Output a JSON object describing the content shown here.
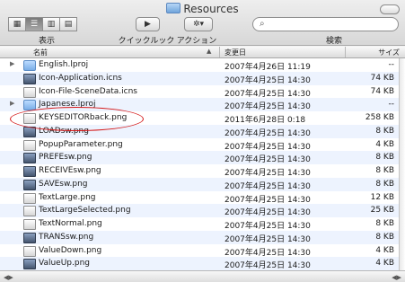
{
  "window": {
    "title": "Resources"
  },
  "toolbar": {
    "view_label": "表示",
    "quicklook_label": "クイックルック",
    "action_label": "アクション",
    "search_label": "検索"
  },
  "columns": {
    "name": "名前",
    "date": "変更日",
    "size": "サイズ"
  },
  "files": [
    {
      "name": "English.lproj",
      "date": "2007年4月26日 11:19",
      "size": "--",
      "type": "folder",
      "expanded": false
    },
    {
      "name": "Icon-Application.icns",
      "date": "2007年4月25日 14:30",
      "size": "74 KB",
      "type": "icns"
    },
    {
      "name": "Icon-File-SceneData.icns",
      "date": "2007年4月25日 14:30",
      "size": "74 KB",
      "type": "icns"
    },
    {
      "name": "Japanese.lproj",
      "date": "2007年4月25日 14:30",
      "size": "--",
      "type": "folder",
      "expanded": false
    },
    {
      "name": "KEYSEDITORback.png",
      "date": "2011年6月28日 0:18",
      "size": "258 KB",
      "type": "png"
    },
    {
      "name": "LOADsw.png",
      "date": "2007年4月25日 14:30",
      "size": "8 KB",
      "type": "png"
    },
    {
      "name": "PopupParameter.png",
      "date": "2007年4月25日 14:30",
      "size": "4 KB",
      "type": "png"
    },
    {
      "name": "PREFEsw.png",
      "date": "2007年4月25日 14:30",
      "size": "8 KB",
      "type": "png"
    },
    {
      "name": "RECEIVEsw.png",
      "date": "2007年4月25日 14:30",
      "size": "8 KB",
      "type": "png"
    },
    {
      "name": "SAVEsw.png",
      "date": "2007年4月25日 14:30",
      "size": "8 KB",
      "type": "png"
    },
    {
      "name": "TextLarge.png",
      "date": "2007年4月25日 14:30",
      "size": "12 KB",
      "type": "png"
    },
    {
      "name": "TextLargeSelected.png",
      "date": "2007年4月25日 14:30",
      "size": "25 KB",
      "type": "png"
    },
    {
      "name": "TextNormal.png",
      "date": "2007年4月25日 14:30",
      "size": "8 KB",
      "type": "png"
    },
    {
      "name": "TRANSsw.png",
      "date": "2007年4月25日 14:30",
      "size": "8 KB",
      "type": "png"
    },
    {
      "name": "ValueDown.png",
      "date": "2007年4月25日 14:30",
      "size": "4 KB",
      "type": "png"
    },
    {
      "name": "ValueUp.png",
      "date": "2007年4月25日 14:30",
      "size": "4 KB",
      "type": "png"
    }
  ],
  "icons": {
    "folder": "folder-icon",
    "document": "document-icon",
    "search": "search-icon",
    "gear": "gear-icon",
    "eye": "quicklook-eye-icon"
  },
  "colors": {
    "highlight_ring": "#d51b1b",
    "row_alt": "#edf3fe"
  }
}
